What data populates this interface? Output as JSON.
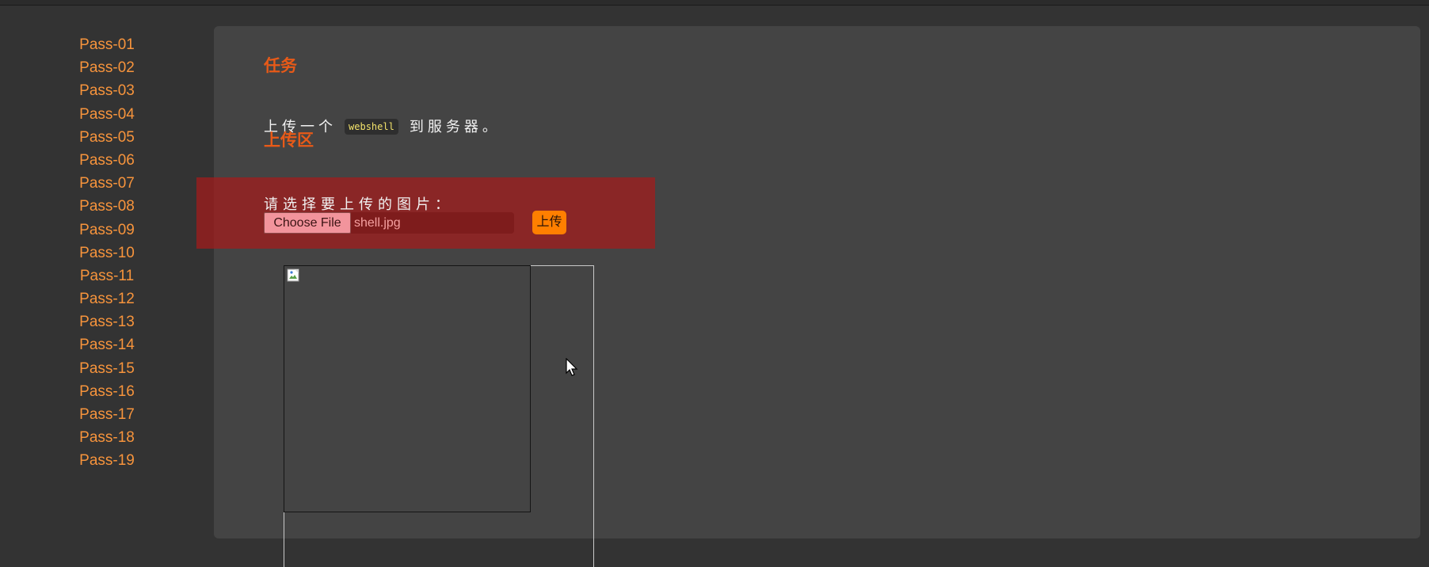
{
  "sidebar": {
    "items": [
      {
        "label": "Pass-01"
      },
      {
        "label": "Pass-02"
      },
      {
        "label": "Pass-03"
      },
      {
        "label": "Pass-04"
      },
      {
        "label": "Pass-05"
      },
      {
        "label": "Pass-06"
      },
      {
        "label": "Pass-07"
      },
      {
        "label": "Pass-08"
      },
      {
        "label": "Pass-09"
      },
      {
        "label": "Pass-10"
      },
      {
        "label": "Pass-11"
      },
      {
        "label": "Pass-12"
      },
      {
        "label": "Pass-13"
      },
      {
        "label": "Pass-14"
      },
      {
        "label": "Pass-15"
      },
      {
        "label": "Pass-16"
      },
      {
        "label": "Pass-17"
      },
      {
        "label": "Pass-18"
      },
      {
        "label": "Pass-19"
      }
    ]
  },
  "main": {
    "task_heading": "任务",
    "task_text_before": "上传一个",
    "task_code": "webshell",
    "task_text_after": "到服务器。",
    "upload_heading": "上传区",
    "select_label": "请选择要上传的图片：",
    "file_button_label": "Choose File",
    "file_name": "shell.jpg",
    "upload_button_label": "上传"
  },
  "icons": {
    "preview": "broken-image-icon",
    "pointer": "mouse-cursor-icon"
  },
  "colors": {
    "background": "#333333",
    "panel": "#444444",
    "link": "#f7943c",
    "heading": "#e85a18",
    "upload_button": "#ff7f00",
    "highlight_overlay": "#a21c1c"
  }
}
